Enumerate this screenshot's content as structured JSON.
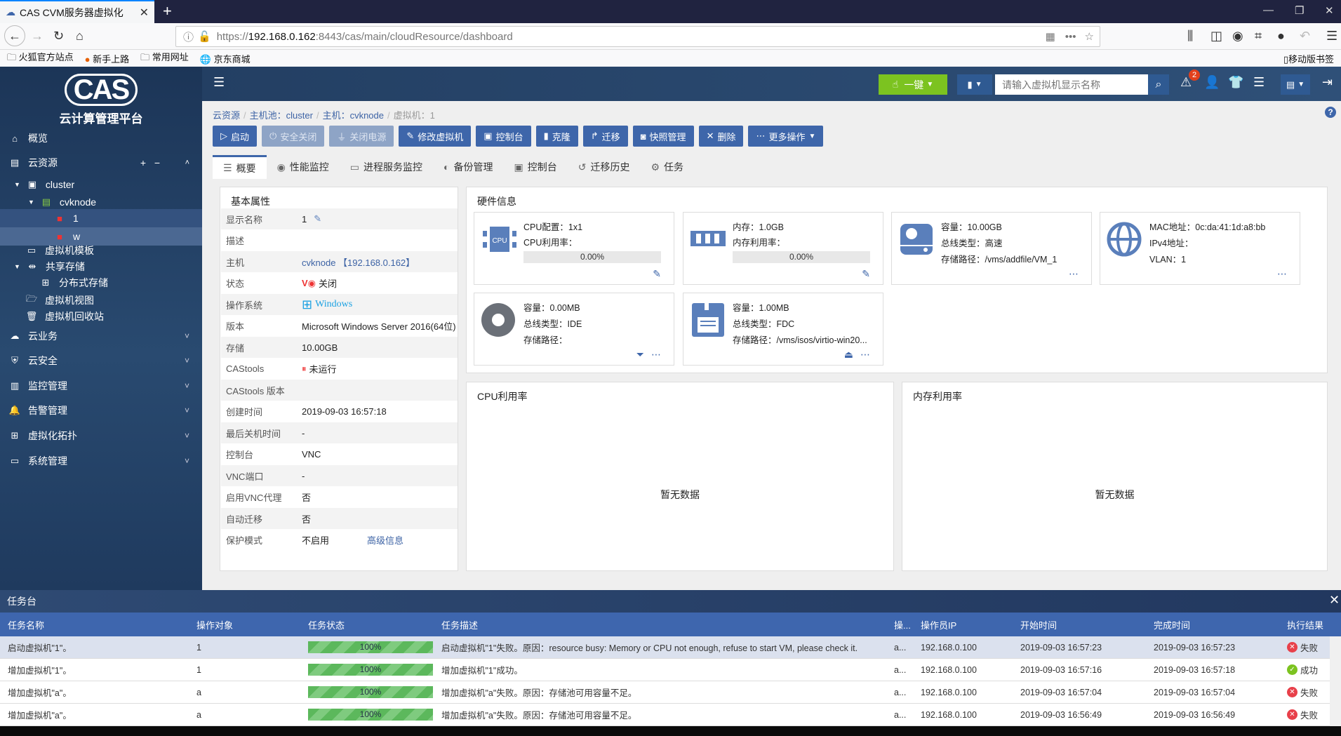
{
  "browser": {
    "tab_title": "CAS CVM服务器虚拟化",
    "url_scheme": "https://",
    "url_host": "192.168.0.162",
    "url_rest": ":8443/cas/main/cloudResource/dashboard",
    "bookmarks": [
      "火狐官方站点",
      "新手上路",
      "常用网址",
      "京东商城"
    ],
    "mobile_bookmarks": "移动版书签"
  },
  "app": {
    "logo_text": "CAS",
    "logo_subtitle": "云计算管理平台",
    "one_click": "一键",
    "search_placeholder": "请输入虚拟机显示名称",
    "alert_count": "2"
  },
  "sidebar": {
    "overview": "概览",
    "cloud_resource": "云资源",
    "tree": {
      "cluster": "cluster",
      "host": "cvknode",
      "vm1": "1",
      "vm2": "w"
    },
    "vm_template": "虚拟机模板",
    "shared_storage": "共享存储",
    "distributed_storage": "分布式存储",
    "vm_view": "虚拟机视图",
    "vm_recycle": "虚拟机回收站",
    "sections": [
      "云业务",
      "云安全",
      "监控管理",
      "告警管理",
      "虚拟化拓扑",
      "系统管理"
    ]
  },
  "breadcrumb": [
    "云资源",
    "主机池：cluster",
    "主机：cvknode",
    "虚拟机：1"
  ],
  "toolbar": [
    {
      "label": "启动",
      "icon": "play",
      "disabled": false
    },
    {
      "label": "安全关闭",
      "icon": "power",
      "disabled": true
    },
    {
      "label": "关闭电源",
      "icon": "plug",
      "disabled": true
    },
    {
      "label": "修改虚拟机",
      "icon": "pencil",
      "disabled": false
    },
    {
      "label": "控制台",
      "icon": "terminal",
      "disabled": false
    },
    {
      "label": "克隆",
      "icon": "clone",
      "disabled": false
    },
    {
      "label": "迁移",
      "icon": "share",
      "disabled": false
    },
    {
      "label": "快照管理",
      "icon": "camera",
      "disabled": false
    },
    {
      "label": "删除",
      "icon": "close",
      "disabled": false
    },
    {
      "label": "更多操作",
      "icon": "more",
      "disabled": false
    }
  ],
  "tabs": [
    {
      "label": "概要",
      "icon": "list"
    },
    {
      "label": "性能监控",
      "icon": "gauge"
    },
    {
      "label": "进程服务监控",
      "icon": "monitor"
    },
    {
      "label": "备份管理",
      "icon": "backup"
    },
    {
      "label": "控制台",
      "icon": "terminal"
    },
    {
      "label": "迁移历史",
      "icon": "history"
    },
    {
      "label": "任务",
      "icon": "gear"
    }
  ],
  "basic": {
    "title": "基本属性",
    "rows": [
      {
        "label": "显示名称",
        "value": "1"
      },
      {
        "label": "描述",
        "value": ""
      },
      {
        "label": "主机",
        "value": "cvknode 【192.168.0.162】"
      },
      {
        "label": "状态",
        "value": "关闭"
      },
      {
        "label": "操作系统",
        "value": "Windows"
      },
      {
        "label": "版本",
        "value": "Microsoft Windows Server 2016(64位)"
      },
      {
        "label": "存储",
        "value": "10.00GB"
      },
      {
        "label": "CAStools",
        "value": "未运行"
      },
      {
        "label": "CAStools 版本",
        "value": ""
      },
      {
        "label": "创建时间",
        "value": "2019-09-03 16:57:18"
      },
      {
        "label": "最后关机时间",
        "value": "-"
      },
      {
        "label": "控制台",
        "value": "VNC"
      },
      {
        "label": "VNC端口",
        "value": "-"
      },
      {
        "label": "启用VNC代理",
        "value": "否"
      },
      {
        "label": "自动迁移",
        "value": "否"
      },
      {
        "label": "保护模式",
        "value": "不启用"
      }
    ],
    "advanced_link": "高级信息"
  },
  "hardware": {
    "title": "硬件信息",
    "cpu": {
      "config": "CPU配置：1x1",
      "usage_label": "CPU利用率：",
      "usage": "0.00%"
    },
    "memory": {
      "size": "内存：1.0GB",
      "usage_label": "内存利用率：",
      "usage": "0.00%"
    },
    "disk": {
      "capacity": "容量：10.00GB",
      "bus": "总线类型：高速",
      "path": "存储路径：/vms/addfile/VM_1"
    },
    "nic": {
      "mac": "MAC地址：0c:da:41:1d:a8:bb",
      "ipv4": "IPv4地址：",
      "vlan": "VLAN：1"
    },
    "cdrom": {
      "capacity": "容量：0.00MB",
      "bus": "总线类型：IDE",
      "path": "存储路径："
    },
    "floppy": {
      "capacity": "容量：1.00MB",
      "bus": "总线类型：FDC",
      "path": "存储路径：/vms/isos/virtio-win20..."
    }
  },
  "charts": {
    "cpu_title": "CPU利用率",
    "mem_title": "内存利用率",
    "no_data": "暂无数据"
  },
  "tasks": {
    "title": "任务台",
    "columns": [
      "任务名称",
      "操作对象",
      "任务状态",
      "任务描述",
      "操...",
      "操作员IP",
      "开始时间",
      "完成时间",
      "执行结果"
    ],
    "rows": [
      {
        "name": "启动虚拟机\"1\"。",
        "target": "1",
        "progress": "100%",
        "desc": "启动虚拟机\"1\"失败。原因：resource busy: Memory or CPU not enough, refuse to start VM, please check it.",
        "op": "a...",
        "ip": "192.168.0.100",
        "start": "2019-09-03 16:57:23",
        "end": "2019-09-03 16:57:23",
        "result": "失败",
        "ok": false
      },
      {
        "name": "增加虚拟机\"1\"。",
        "target": "1",
        "progress": "100%",
        "desc": "增加虚拟机\"1\"成功。",
        "op": "a...",
        "ip": "192.168.0.100",
        "start": "2019-09-03 16:57:16",
        "end": "2019-09-03 16:57:18",
        "result": "成功",
        "ok": true
      },
      {
        "name": "增加虚拟机\"a\"。",
        "target": "a",
        "progress": "100%",
        "desc": "增加虚拟机\"a\"失败。原因：存储池可用容量不足。",
        "op": "a...",
        "ip": "192.168.0.100",
        "start": "2019-09-03 16:57:04",
        "end": "2019-09-03 16:57:04",
        "result": "失败",
        "ok": false
      },
      {
        "name": "增加虚拟机\"a\"。",
        "target": "a",
        "progress": "100%",
        "desc": "增加虚拟机\"a\"失败。原因：存储池可用容量不足。",
        "op": "a...",
        "ip": "192.168.0.100",
        "start": "2019-09-03 16:56:49",
        "end": "2019-09-03 16:56:49",
        "result": "失败",
        "ok": false
      }
    ]
  },
  "colors": {
    "primary": "#3e66aa",
    "success": "#7cc320",
    "danger": "#e8404a",
    "sidebar": "#1c3557"
  }
}
